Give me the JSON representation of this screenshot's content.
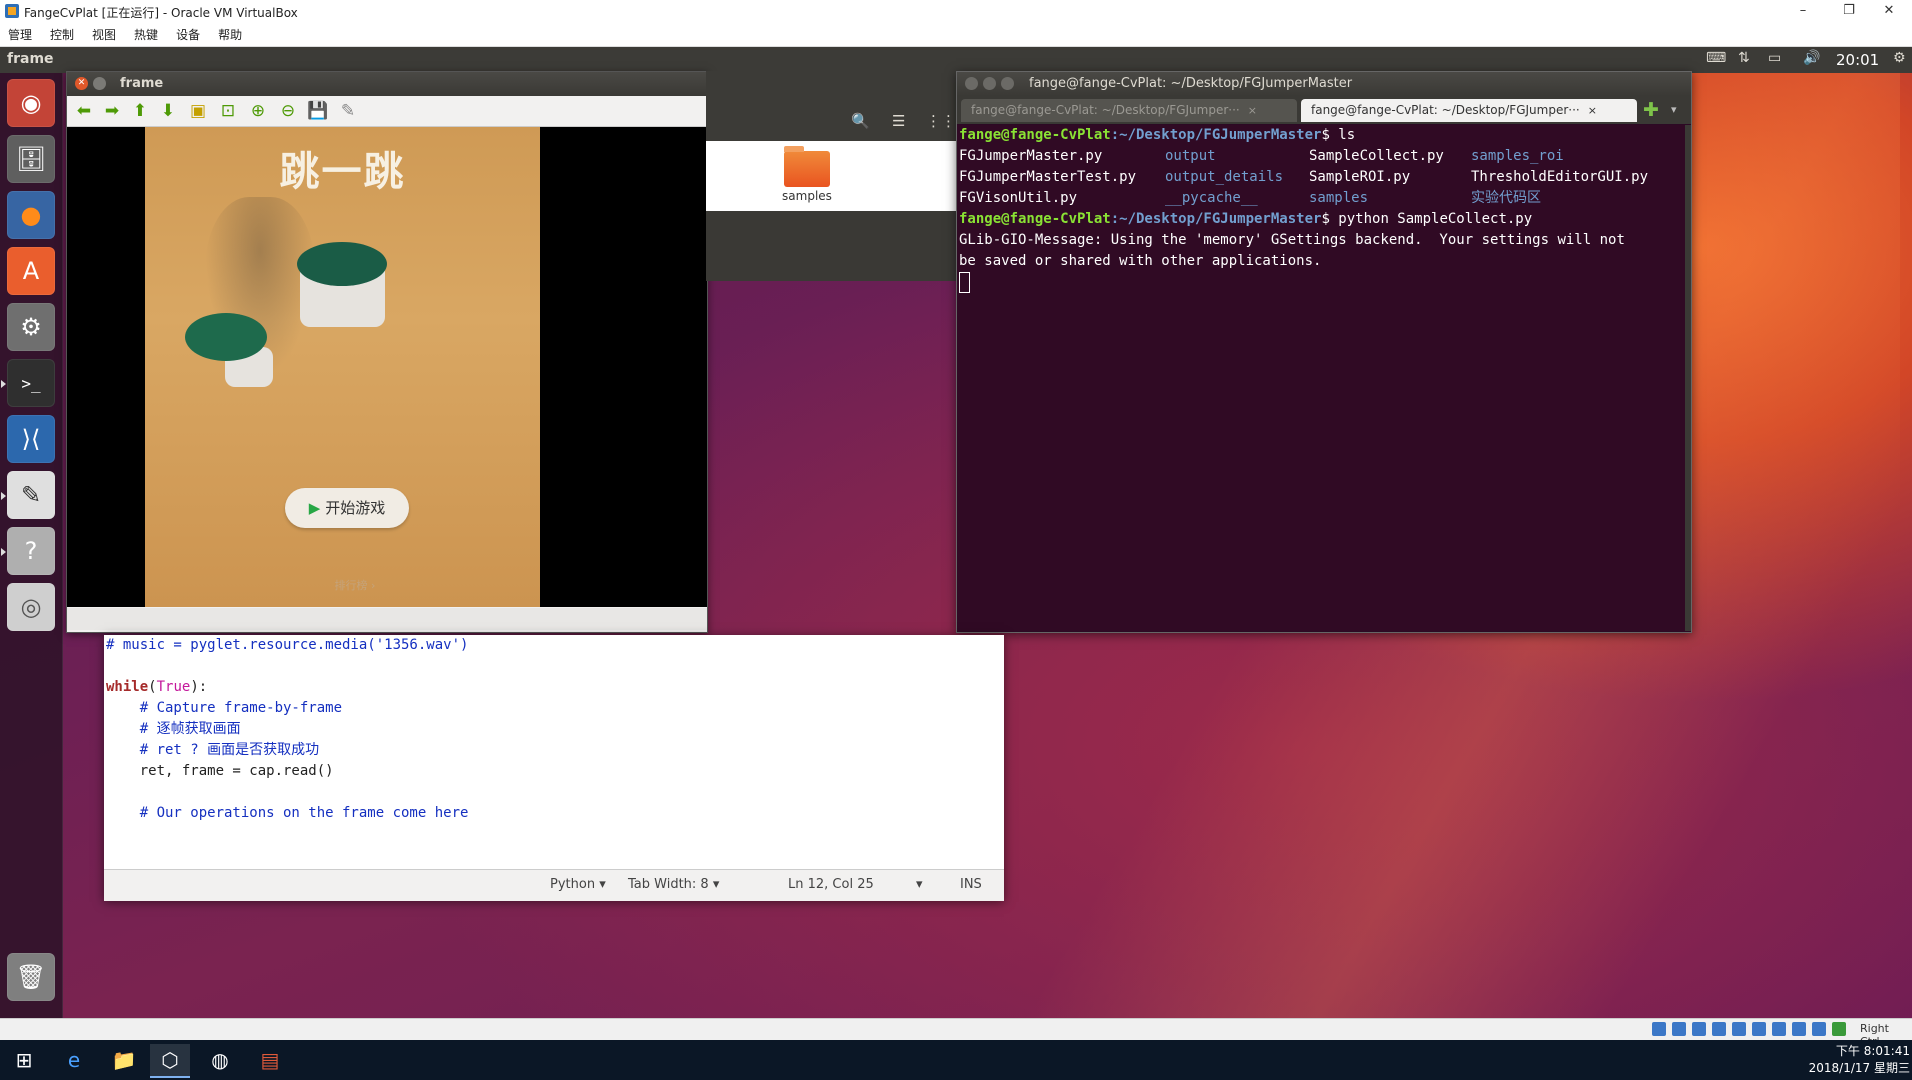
{
  "vbox": {
    "title": "FangeCvPlat [正在运行] - Oracle VM VirtualBox",
    "menus": [
      "管理",
      "控制",
      "视图",
      "热键",
      "设备",
      "帮助"
    ],
    "hostkey": "Right Ctrl"
  },
  "ubuntu": {
    "topbar_title": "frame",
    "clock": "20:01"
  },
  "frame_window": {
    "title": "frame",
    "game_title": "跳一跳",
    "start_button": "开始游戏",
    "rank_label": "排行榜 ›"
  },
  "file_manager": {
    "folder_label": "samples"
  },
  "terminal": {
    "title": "fange@fange-CvPlat: ~/Desktop/FGJumperMaster",
    "tabs": [
      "fange@fange-CvPlat: ~/Desktop/FGJumper···",
      "fange@fange-CvPlat: ~/Desktop/FGJumper···"
    ],
    "prompt_user": "fange@fange-CvPlat",
    "prompt_path": ":~/Desktop/FGJumperMaster",
    "cmd1": "$ ls",
    "ls_rows": [
      [
        "FGJumperMaster.py",
        "output",
        "SampleCollect.py",
        "samples_roi"
      ],
      [
        "FGJumperMasterTest.py",
        "output_details",
        "SampleROI.py",
        "ThresholdEditorGUI.py"
      ],
      [
        "FGVisonUtil.py",
        "__pycache__",
        "samples",
        "实验代码区"
      ]
    ],
    "cmd2": "$ python SampleCollect.py",
    "msg_prefix": "GLib-GIO-Message",
    "msg_line1": ": Using the 'memory' GSettings backend.  Your settings will not",
    "msg_line2": "be saved or shared with other applications."
  },
  "editor": {
    "lines": {
      "l1": "# music = pyglet.resource.media('1356.wav')",
      "l3_kw": "while",
      "l3_open": "(",
      "l3_true": "True",
      "l3_close": "):",
      "l4": "    # Capture frame-by-frame",
      "l5": "    # 逐帧获取画面",
      "l6": "    # ret ? 画面是否获取成功",
      "l7": "    ret, frame = cap.read()",
      "l9": "    # Our operations on the frame come here"
    },
    "status": {
      "language": "Python ▾",
      "tab_width": "Tab Width: 8 ▾",
      "position": "Ln 12, Col 25",
      "dropdown": "▾",
      "mode": "INS"
    }
  },
  "windows_clock": {
    "time": "下午 8:01:41",
    "date": "2018/1/17 星期三"
  }
}
